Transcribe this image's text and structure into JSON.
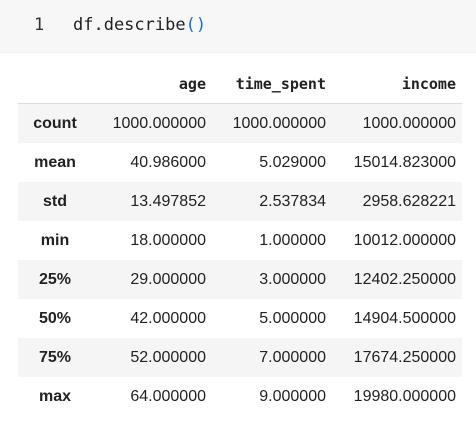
{
  "cell": {
    "line_number": "1",
    "code_prefix": "df.describe",
    "code_parens": "()"
  },
  "table": {
    "columns": [
      "age",
      "time_spent",
      "income"
    ],
    "rows": [
      {
        "label": "count",
        "values": [
          "1000.000000",
          "1000.000000",
          "1000.000000"
        ]
      },
      {
        "label": "mean",
        "values": [
          "40.986000",
          "5.029000",
          "15014.823000"
        ]
      },
      {
        "label": "std",
        "values": [
          "13.497852",
          "2.537834",
          "2958.628221"
        ]
      },
      {
        "label": "min",
        "values": [
          "18.000000",
          "1.000000",
          "10012.000000"
        ]
      },
      {
        "label": "25%",
        "values": [
          "29.000000",
          "3.000000",
          "12402.250000"
        ]
      },
      {
        "label": "50%",
        "values": [
          "42.000000",
          "5.000000",
          "14904.500000"
        ]
      },
      {
        "label": "75%",
        "values": [
          "52.000000",
          "7.000000",
          "17674.250000"
        ]
      },
      {
        "label": "max",
        "values": [
          "64.000000",
          "9.000000",
          "19980.000000"
        ]
      }
    ]
  },
  "colors": {
    "cell_background": "#f7f7f7",
    "paren_color": "#1a6ed8",
    "stripe": "#f5f5f5"
  }
}
